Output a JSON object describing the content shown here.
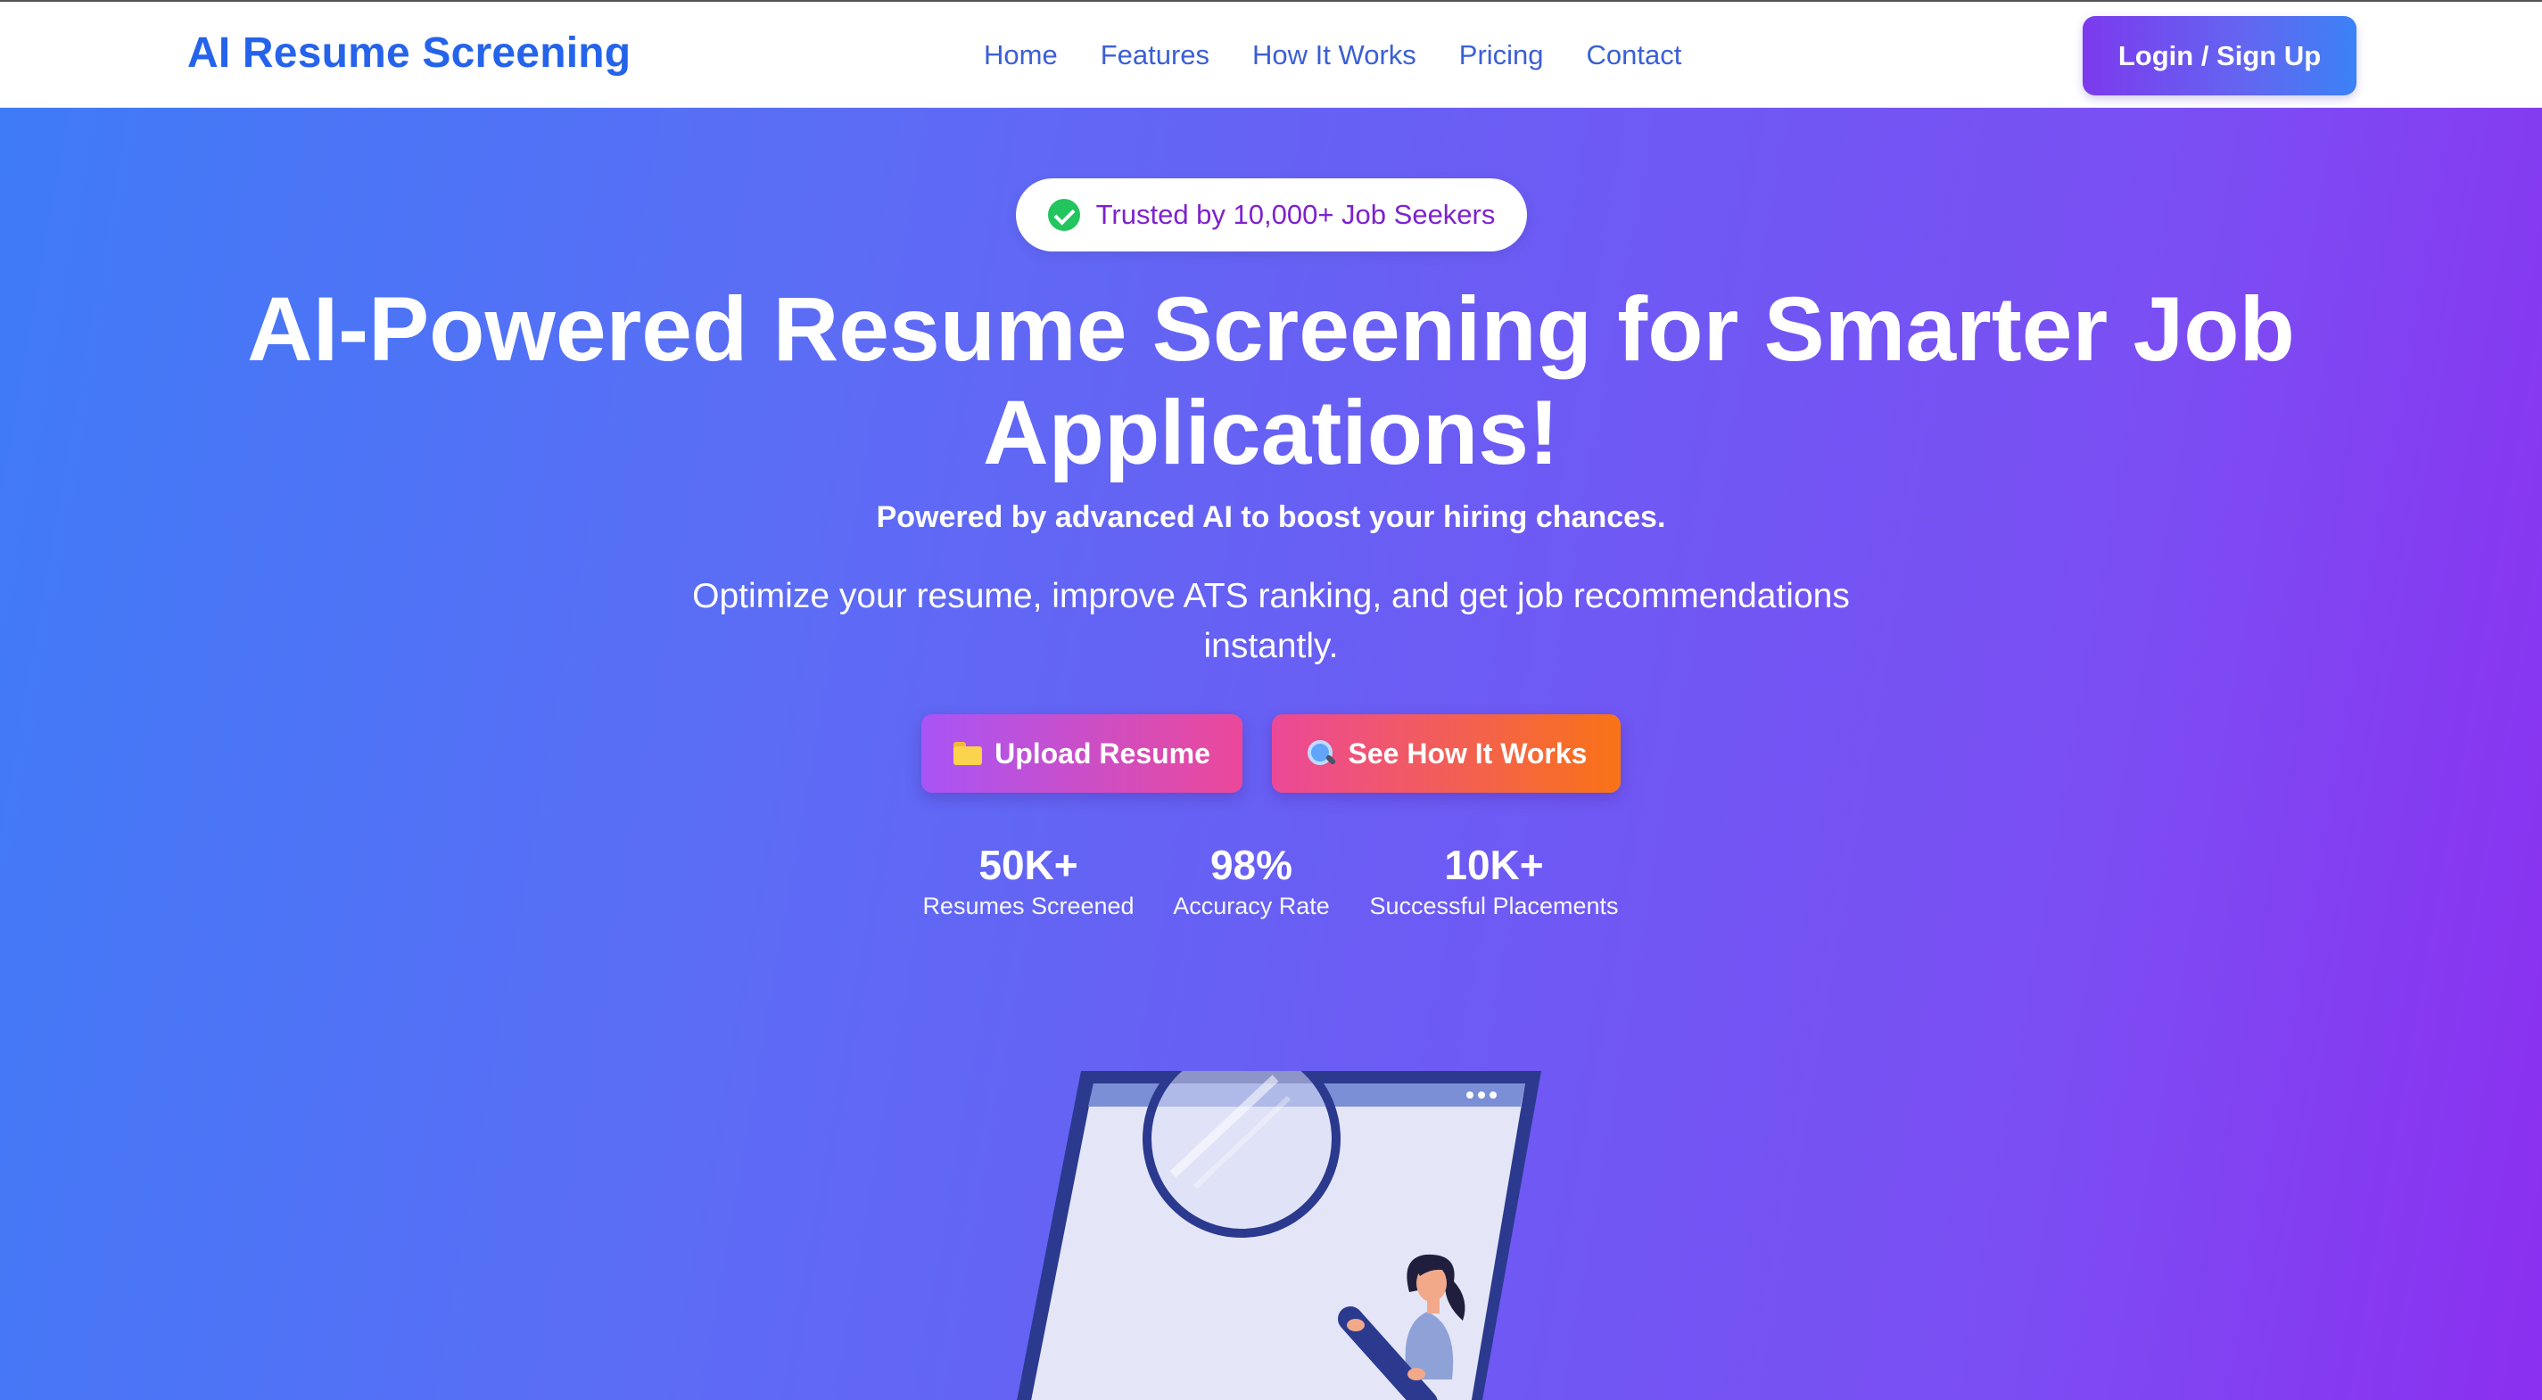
{
  "nav": {
    "brand": "AI Resume Screening",
    "links": [
      {
        "label": "Home"
      },
      {
        "label": "Features"
      },
      {
        "label": "How It Works"
      },
      {
        "label": "Pricing"
      },
      {
        "label": "Contact"
      }
    ],
    "login_label": "Login / Sign Up"
  },
  "hero": {
    "badge_text": "Trusted by 10,000+ Job Seekers",
    "headline_line1": "AI-Powered Resume Screening for Smarter Job",
    "headline_line2": "Applications!",
    "subhead": "Powered by advanced AI to boost your hiring chances.",
    "description_line1": "Optimize your resume, improve ATS ranking, and get job recommendations",
    "description_line2": "instantly.",
    "upload_label": "Upload Resume",
    "how_label": "See How It Works",
    "stats": [
      {
        "value": "50K+",
        "label": "Resumes Screened"
      },
      {
        "value": "98%",
        "label": "Accuracy Rate"
      },
      {
        "value": "10K+",
        "label": "Successful Placements"
      }
    ]
  },
  "colors": {
    "brand": "#2563eb",
    "nav_link": "#3b5fd6",
    "badge_text": "#7e22ce",
    "check": "#22c55e"
  }
}
